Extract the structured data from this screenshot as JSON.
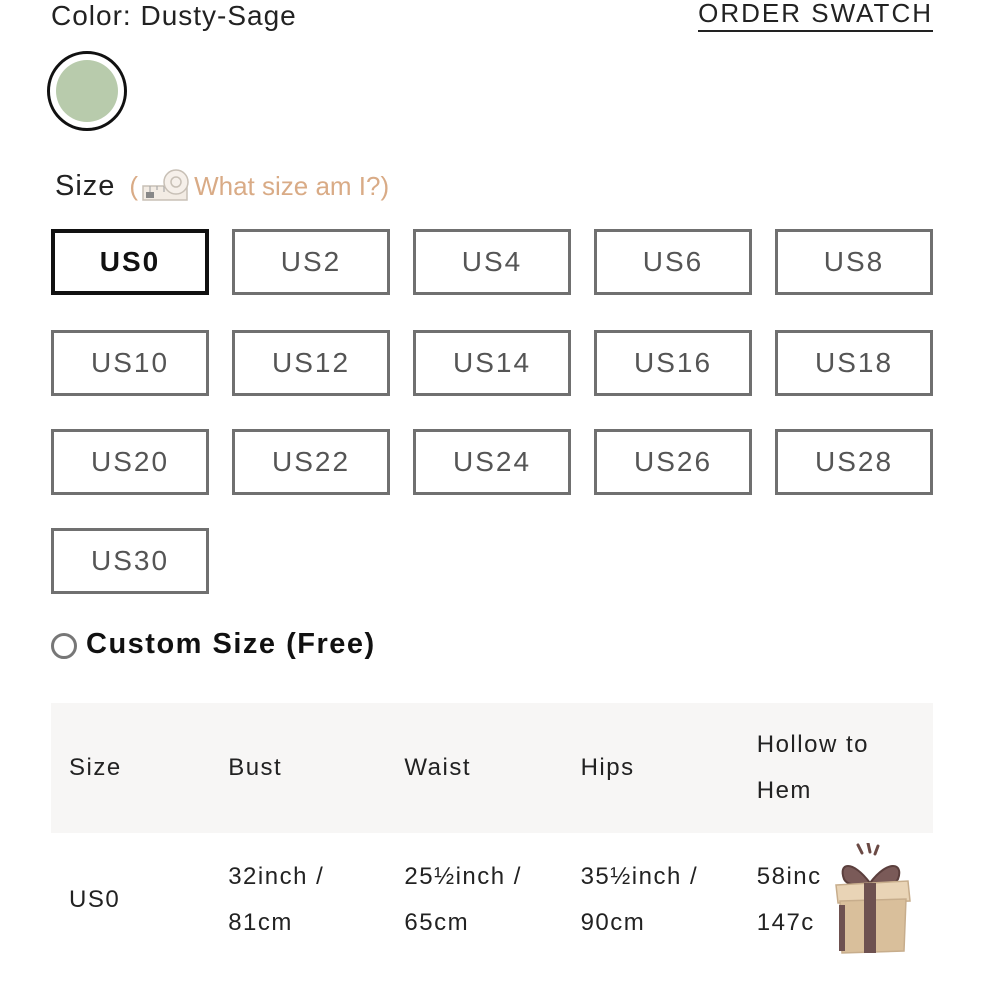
{
  "color": {
    "label": "Color: Dusty-Sage",
    "order_swatch": "ORDER SWATCH",
    "swatch_hex": "#b8cbac"
  },
  "size_picker": {
    "title": "Size",
    "help_open": "(",
    "help_text": "What size am I?)",
    "help_color": "#d9ab86",
    "selected": "US0",
    "options": [
      "US0",
      "US2",
      "US4",
      "US6",
      "US8",
      "US10",
      "US12",
      "US14",
      "US16",
      "US18",
      "US20",
      "US22",
      "US24",
      "US26",
      "US28",
      "US30"
    ]
  },
  "custom_size": {
    "label": "Custom Size (Free)"
  },
  "size_table": {
    "headers": [
      "Size",
      "Bust",
      "Waist",
      "Hips",
      "Hollow to Hem"
    ],
    "rows": [
      {
        "size": "US0",
        "bust": [
          "32inch /",
          "81cm"
        ],
        "waist": [
          "25½inch /",
          "65cm"
        ],
        "hips": [
          "35½inch /",
          "90cm"
        ],
        "hollow_to_hem": [
          "58inc",
          "147c"
        ]
      }
    ]
  }
}
